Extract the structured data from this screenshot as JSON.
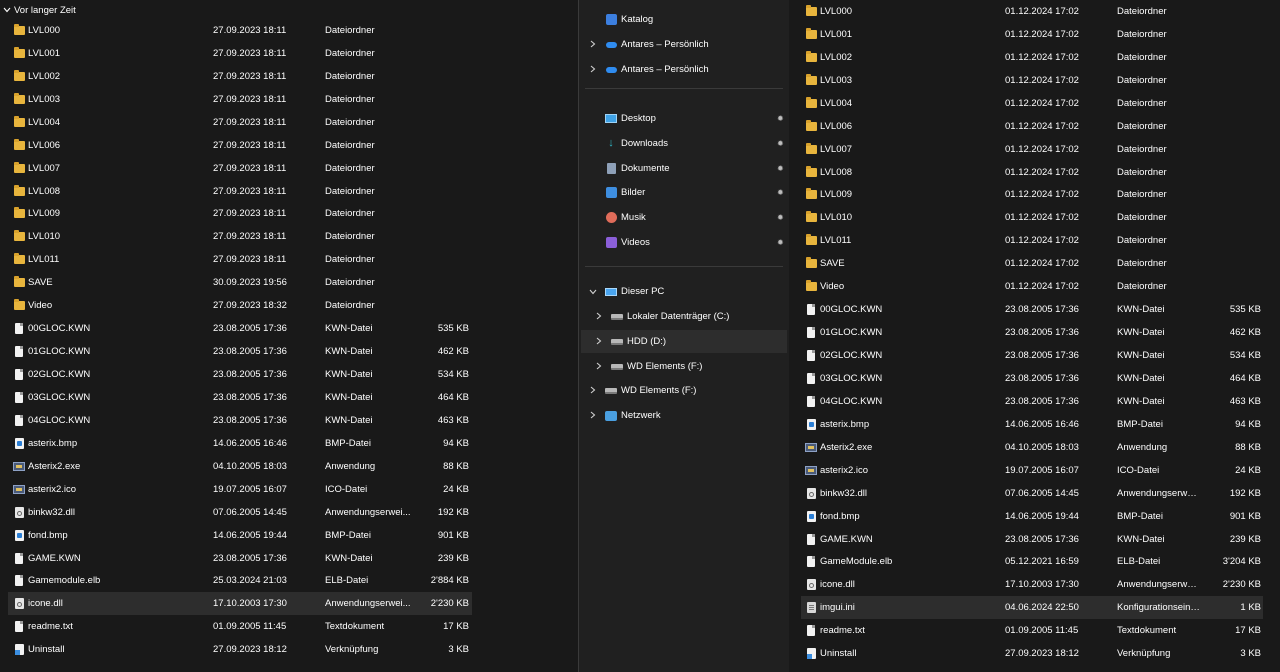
{
  "left": {
    "group_header": "Vor langer Zeit",
    "files": [
      {
        "name": "LVL000",
        "date": "27.09.2023 18:11",
        "type": "Dateiordner",
        "size": "",
        "icon": "folder"
      },
      {
        "name": "LVL001",
        "date": "27.09.2023 18:11",
        "type": "Dateiordner",
        "size": "",
        "icon": "folder"
      },
      {
        "name": "LVL002",
        "date": "27.09.2023 18:11",
        "type": "Dateiordner",
        "size": "",
        "icon": "folder"
      },
      {
        "name": "LVL003",
        "date": "27.09.2023 18:11",
        "type": "Dateiordner",
        "size": "",
        "icon": "folder"
      },
      {
        "name": "LVL004",
        "date": "27.09.2023 18:11",
        "type": "Dateiordner",
        "size": "",
        "icon": "folder"
      },
      {
        "name": "LVL006",
        "date": "27.09.2023 18:11",
        "type": "Dateiordner",
        "size": "",
        "icon": "folder"
      },
      {
        "name": "LVL007",
        "date": "27.09.2023 18:11",
        "type": "Dateiordner",
        "size": "",
        "icon": "folder"
      },
      {
        "name": "LVL008",
        "date": "27.09.2023 18:11",
        "type": "Dateiordner",
        "size": "",
        "icon": "folder"
      },
      {
        "name": "LVL009",
        "date": "27.09.2023 18:11",
        "type": "Dateiordner",
        "size": "",
        "icon": "folder"
      },
      {
        "name": "LVL010",
        "date": "27.09.2023 18:11",
        "type": "Dateiordner",
        "size": "",
        "icon": "folder"
      },
      {
        "name": "LVL011",
        "date": "27.09.2023 18:11",
        "type": "Dateiordner",
        "size": "",
        "icon": "folder"
      },
      {
        "name": "SAVE",
        "date": "30.09.2023 19:56",
        "type": "Dateiordner",
        "size": "",
        "icon": "folder"
      },
      {
        "name": "Video",
        "date": "27.09.2023 18:32",
        "type": "Dateiordner",
        "size": "",
        "icon": "folder"
      },
      {
        "name": "00GLOC.KWN",
        "date": "23.08.2005 17:36",
        "type": "KWN-Datei",
        "size": "535 KB",
        "icon": "doc"
      },
      {
        "name": "01GLOC.KWN",
        "date": "23.08.2005 17:36",
        "type": "KWN-Datei",
        "size": "462 KB",
        "icon": "doc"
      },
      {
        "name": "02GLOC.KWN",
        "date": "23.08.2005 17:36",
        "type": "KWN-Datei",
        "size": "534 KB",
        "icon": "doc"
      },
      {
        "name": "03GLOC.KWN",
        "date": "23.08.2005 17:36",
        "type": "KWN-Datei",
        "size": "464 KB",
        "icon": "doc"
      },
      {
        "name": "04GLOC.KWN",
        "date": "23.08.2005 17:36",
        "type": "KWN-Datei",
        "size": "463 KB",
        "icon": "doc"
      },
      {
        "name": "asterix.bmp",
        "date": "14.06.2005 16:46",
        "type": "BMP-Datei",
        "size": "94 KB",
        "icon": "img"
      },
      {
        "name": "Asterix2.exe",
        "date": "04.10.2005 18:03",
        "type": "Anwendung",
        "size": "88 KB",
        "icon": "exe"
      },
      {
        "name": "asterix2.ico",
        "date": "19.07.2005 16:07",
        "type": "ICO-Datei",
        "size": "24 KB",
        "icon": "exe"
      },
      {
        "name": "binkw32.dll",
        "date": "07.06.2005 14:45",
        "type": "Anwendungserwei...",
        "size": "192 KB",
        "icon": "dll"
      },
      {
        "name": "fond.bmp",
        "date": "14.06.2005 19:44",
        "type": "BMP-Datei",
        "size": "901 KB",
        "icon": "img"
      },
      {
        "name": "GAME.KWN",
        "date": "23.08.2005 17:36",
        "type": "KWN-Datei",
        "size": "239 KB",
        "icon": "doc"
      },
      {
        "name": "Gamemodule.elb",
        "date": "25.03.2024 21:03",
        "type": "ELB-Datei",
        "size": "2'884 KB",
        "icon": "doc"
      },
      {
        "name": "icone.dll",
        "date": "17.10.2003 17:30",
        "type": "Anwendungserwei...",
        "size": "2'230 KB",
        "icon": "dll",
        "selected": true
      },
      {
        "name": "readme.txt",
        "date": "01.09.2005 11:45",
        "type": "Textdokument",
        "size": "17 KB",
        "icon": "doc"
      },
      {
        "name": "Uninstall",
        "date": "27.09.2023 18:12",
        "type": "Verknüpfung",
        "size": "3 KB",
        "icon": "lnk"
      }
    ]
  },
  "nav": {
    "items": [
      {
        "label": "Katalog",
        "icon": "catalog-icon",
        "chevron": false,
        "pin": false,
        "indent": 0
      },
      {
        "label": "Antares – Persönlich",
        "icon": "cloud-icon",
        "chevron": true,
        "pin": false,
        "indent": 0
      },
      {
        "label": "Antares – Persönlich",
        "icon": "cloud-icon",
        "chevron": true,
        "pin": false,
        "indent": 0
      },
      {
        "label": "Desktop",
        "icon": "desktop-icon",
        "chevron": false,
        "pin": true,
        "indent": 0
      },
      {
        "label": "Downloads",
        "icon": "download-icon",
        "chevron": false,
        "pin": true,
        "indent": 0
      },
      {
        "label": "Dokumente",
        "icon": "documents-icon",
        "chevron": false,
        "pin": true,
        "indent": 0
      },
      {
        "label": "Bilder",
        "icon": "pictures-icon",
        "chevron": false,
        "pin": true,
        "indent": 0
      },
      {
        "label": "Musik",
        "icon": "music-icon",
        "chevron": false,
        "pin": true,
        "indent": 0
      },
      {
        "label": "Videos",
        "icon": "videos-icon",
        "chevron": false,
        "pin": true,
        "indent": 0
      },
      {
        "label": "Dieser PC",
        "icon": "pc-icon",
        "chevron": true,
        "expanded": true,
        "pin": false,
        "indent": 0
      },
      {
        "label": "Lokaler Datenträger (C:)",
        "icon": "drive-icon",
        "chevron": true,
        "pin": false,
        "indent": 1
      },
      {
        "label": "HDD (D:)",
        "icon": "drive-icon",
        "chevron": true,
        "pin": false,
        "indent": 1,
        "selected": true
      },
      {
        "label": "WD Elements (F:)",
        "icon": "drive-icon",
        "chevron": true,
        "pin": false,
        "indent": 1
      },
      {
        "label": "WD Elements (F:)",
        "icon": "drive-icon",
        "chevron": true,
        "pin": false,
        "indent": 0
      },
      {
        "label": "Netzwerk",
        "icon": "network-icon",
        "chevron": true,
        "pin": false,
        "indent": 0
      }
    ]
  },
  "right": {
    "files": [
      {
        "name": "LVL000",
        "date": "01.12.2024 17:02",
        "type": "Dateiordner",
        "size": "",
        "icon": "folder"
      },
      {
        "name": "LVL001",
        "date": "01.12.2024 17:02",
        "type": "Dateiordner",
        "size": "",
        "icon": "folder"
      },
      {
        "name": "LVL002",
        "date": "01.12.2024 17:02",
        "type": "Dateiordner",
        "size": "",
        "icon": "folder"
      },
      {
        "name": "LVL003",
        "date": "01.12.2024 17:02",
        "type": "Dateiordner",
        "size": "",
        "icon": "folder"
      },
      {
        "name": "LVL004",
        "date": "01.12.2024 17:02",
        "type": "Dateiordner",
        "size": "",
        "icon": "folder"
      },
      {
        "name": "LVL006",
        "date": "01.12.2024 17:02",
        "type": "Dateiordner",
        "size": "",
        "icon": "folder"
      },
      {
        "name": "LVL007",
        "date": "01.12.2024 17:02",
        "type": "Dateiordner",
        "size": "",
        "icon": "folder"
      },
      {
        "name": "LVL008",
        "date": "01.12.2024 17:02",
        "type": "Dateiordner",
        "size": "",
        "icon": "folder"
      },
      {
        "name": "LVL009",
        "date": "01.12.2024 17:02",
        "type": "Dateiordner",
        "size": "",
        "icon": "folder"
      },
      {
        "name": "LVL010",
        "date": "01.12.2024 17:02",
        "type": "Dateiordner",
        "size": "",
        "icon": "folder"
      },
      {
        "name": "LVL011",
        "date": "01.12.2024 17:02",
        "type": "Dateiordner",
        "size": "",
        "icon": "folder"
      },
      {
        "name": "SAVE",
        "date": "01.12.2024 17:02",
        "type": "Dateiordner",
        "size": "",
        "icon": "folder"
      },
      {
        "name": "Video",
        "date": "01.12.2024 17:02",
        "type": "Dateiordner",
        "size": "",
        "icon": "folder"
      },
      {
        "name": "00GLOC.KWN",
        "date": "23.08.2005 17:36",
        "type": "KWN-Datei",
        "size": "535 KB",
        "icon": "doc"
      },
      {
        "name": "01GLOC.KWN",
        "date": "23.08.2005 17:36",
        "type": "KWN-Datei",
        "size": "462 KB",
        "icon": "doc"
      },
      {
        "name": "02GLOC.KWN",
        "date": "23.08.2005 17:36",
        "type": "KWN-Datei",
        "size": "534 KB",
        "icon": "doc"
      },
      {
        "name": "03GLOC.KWN",
        "date": "23.08.2005 17:36",
        "type": "KWN-Datei",
        "size": "464 KB",
        "icon": "doc"
      },
      {
        "name": "04GLOC.KWN",
        "date": "23.08.2005 17:36",
        "type": "KWN-Datei",
        "size": "463 KB",
        "icon": "doc"
      },
      {
        "name": "asterix.bmp",
        "date": "14.06.2005 16:46",
        "type": "BMP-Datei",
        "size": "94 KB",
        "icon": "img"
      },
      {
        "name": "Asterix2.exe",
        "date": "04.10.2005 18:03",
        "type": "Anwendung",
        "size": "88 KB",
        "icon": "exe"
      },
      {
        "name": "asterix2.ico",
        "date": "19.07.2005 16:07",
        "type": "ICO-Datei",
        "size": "24 KB",
        "icon": "exe"
      },
      {
        "name": "binkw32.dll",
        "date": "07.06.2005 14:45",
        "type": "Anwendungserwei...",
        "size": "192 KB",
        "icon": "dll"
      },
      {
        "name": "fond.bmp",
        "date": "14.06.2005 19:44",
        "type": "BMP-Datei",
        "size": "901 KB",
        "icon": "img"
      },
      {
        "name": "GAME.KWN",
        "date": "23.08.2005 17:36",
        "type": "KWN-Datei",
        "size": "239 KB",
        "icon": "doc"
      },
      {
        "name": "GameModule.elb",
        "date": "05.12.2021 16:59",
        "type": "ELB-Datei",
        "size": "3'204 KB",
        "icon": "doc"
      },
      {
        "name": "icone.dll",
        "date": "17.10.2003 17:30",
        "type": "Anwendungserwei...",
        "size": "2'230 KB",
        "icon": "dll"
      },
      {
        "name": "imgui.ini",
        "date": "04.06.2024 22:50",
        "type": "Konfigurationseins...",
        "size": "1 KB",
        "icon": "ini",
        "selected": true
      },
      {
        "name": "readme.txt",
        "date": "01.09.2005 11:45",
        "type": "Textdokument",
        "size": "17 KB",
        "icon": "doc"
      },
      {
        "name": "Uninstall",
        "date": "27.09.2023 18:12",
        "type": "Verknüpfung",
        "size": "3 KB",
        "icon": "lnk"
      }
    ]
  }
}
